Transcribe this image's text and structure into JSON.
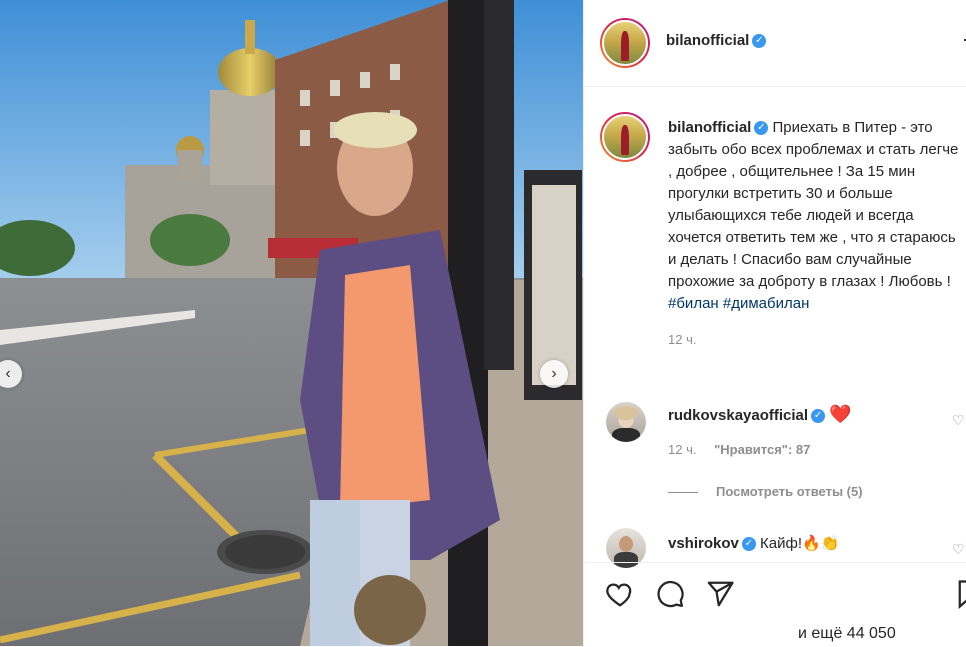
{
  "post": {
    "username": "bilanofficial",
    "caption": "Приехать в Питер - это забыть обо всех проблемах и стать легче , добрее , общительнее ! За 15 мин прогулки встретить 30 и больше улыбающихся тебе людей и всегда хочется ответить тем же , что я стараюсь и делать ! Спасибо вам случайные прохожие за доброту в глазах ! Любовь !",
    "hashtags": [
      "#билан",
      "#димабилан"
    ],
    "time": "12 ч."
  },
  "comments": [
    {
      "username": "rudkovskayaofficial",
      "text": "❤️",
      "time": "12 ч.",
      "likes": "\"Нравится\": 87",
      "view_replies": "Посмотреть ответы (5)"
    },
    {
      "username": "vshirokov",
      "text": "Кайф!🔥👏"
    }
  ],
  "footer": {
    "likes_text": "и ещё 44 050"
  },
  "icons": {
    "more": "more-options-icon",
    "like": "heart-icon",
    "comment": "comment-icon",
    "share": "share-icon",
    "save": "bookmark-icon"
  },
  "colors": {
    "verified": "#3897f0",
    "hashtag": "#00376b",
    "heart": "#ed4956",
    "muted": "#8e8e8e"
  }
}
